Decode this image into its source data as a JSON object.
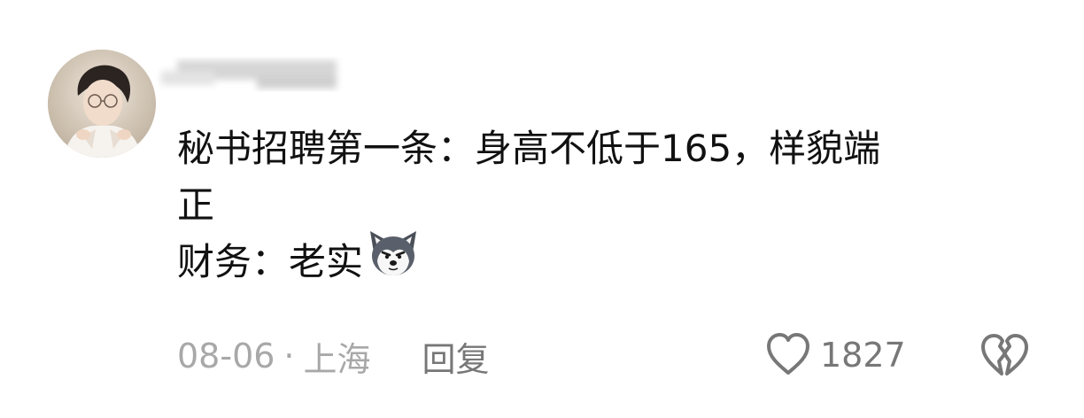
{
  "comment": {
    "body_line1": "秘书招聘第一条：身高不低于165，样貌端",
    "body_line2": "正",
    "body_line3": "财务：老实",
    "emoji": "husky-emoji",
    "date": "08-06",
    "separator": "·",
    "location": "上海",
    "reply_label": "回复",
    "like_count": "1827",
    "icons": {
      "like": "heart-outline-icon",
      "dislike": "broken-heart-icon"
    },
    "colors": {
      "text": "#111111",
      "meta": "#a8a8a8",
      "action": "#777777"
    }
  }
}
